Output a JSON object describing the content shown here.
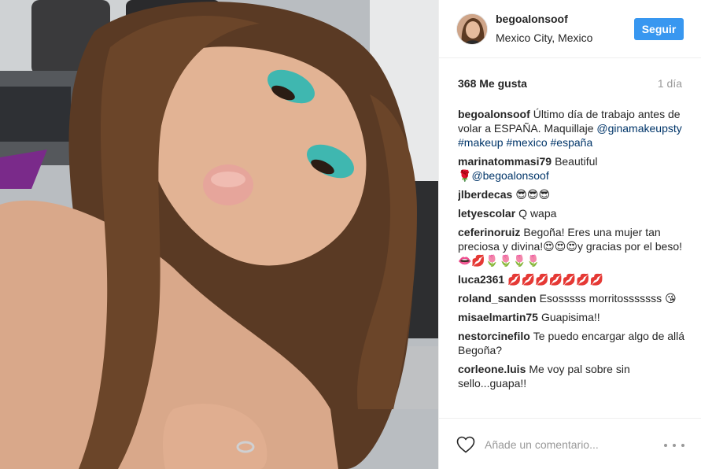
{
  "post": {
    "image_alt": "Selfie photo",
    "header": {
      "username": "begoalonsoof",
      "location": "Mexico City, Mexico",
      "follow_label": "Seguir"
    },
    "likes": "368 Me gusta",
    "time": "1 día",
    "caption": {
      "user": "begoalonsoof",
      "text_1": "Último día de trabajo antes de volar a ESPAÑA. Maquillaje ",
      "tag_1": "@ginamakeupsty",
      "tag_2": "#makeup",
      "tag_3": "#mexico",
      "tag_4": "#españa"
    },
    "comments": [
      {
        "user": "marinatommasi79",
        "text": "Beautiful ",
        "emoji": "🌹",
        "tag": "@begoalonsoof"
      },
      {
        "user": "jlberdecas",
        "text": "😎😎😎"
      },
      {
        "user": "letyescolar",
        "text": "Q wapa"
      },
      {
        "user": "ceferinoruiz",
        "text": "Begoña! Eres una mujer tan preciosa y divina!😍😍😍y gracias por el beso!👄💋🌷🌷🌷🌷"
      },
      {
        "user": "luca2361",
        "text": "💋💋💋💋💋💋💋"
      },
      {
        "user": "roland_sanden",
        "text": "Esosssss morritosssssss 😘"
      },
      {
        "user": "misaelmartin75",
        "text": "Guapisima!!"
      },
      {
        "user": "nestorcinefilo",
        "text": "Te puedo encargar algo de allá Begoña?"
      },
      {
        "user": "corleone.luis",
        "text": "Me voy pal sobre sin sello...guapa!!"
      }
    ],
    "add_comment_placeholder": "Añade un comentario..."
  },
  "icons": {
    "like": "heart-icon",
    "options": "more-options-icon"
  },
  "colors": {
    "follow_button": "#3897f0",
    "tag_link": "#003569",
    "muted_text": "#999999"
  }
}
